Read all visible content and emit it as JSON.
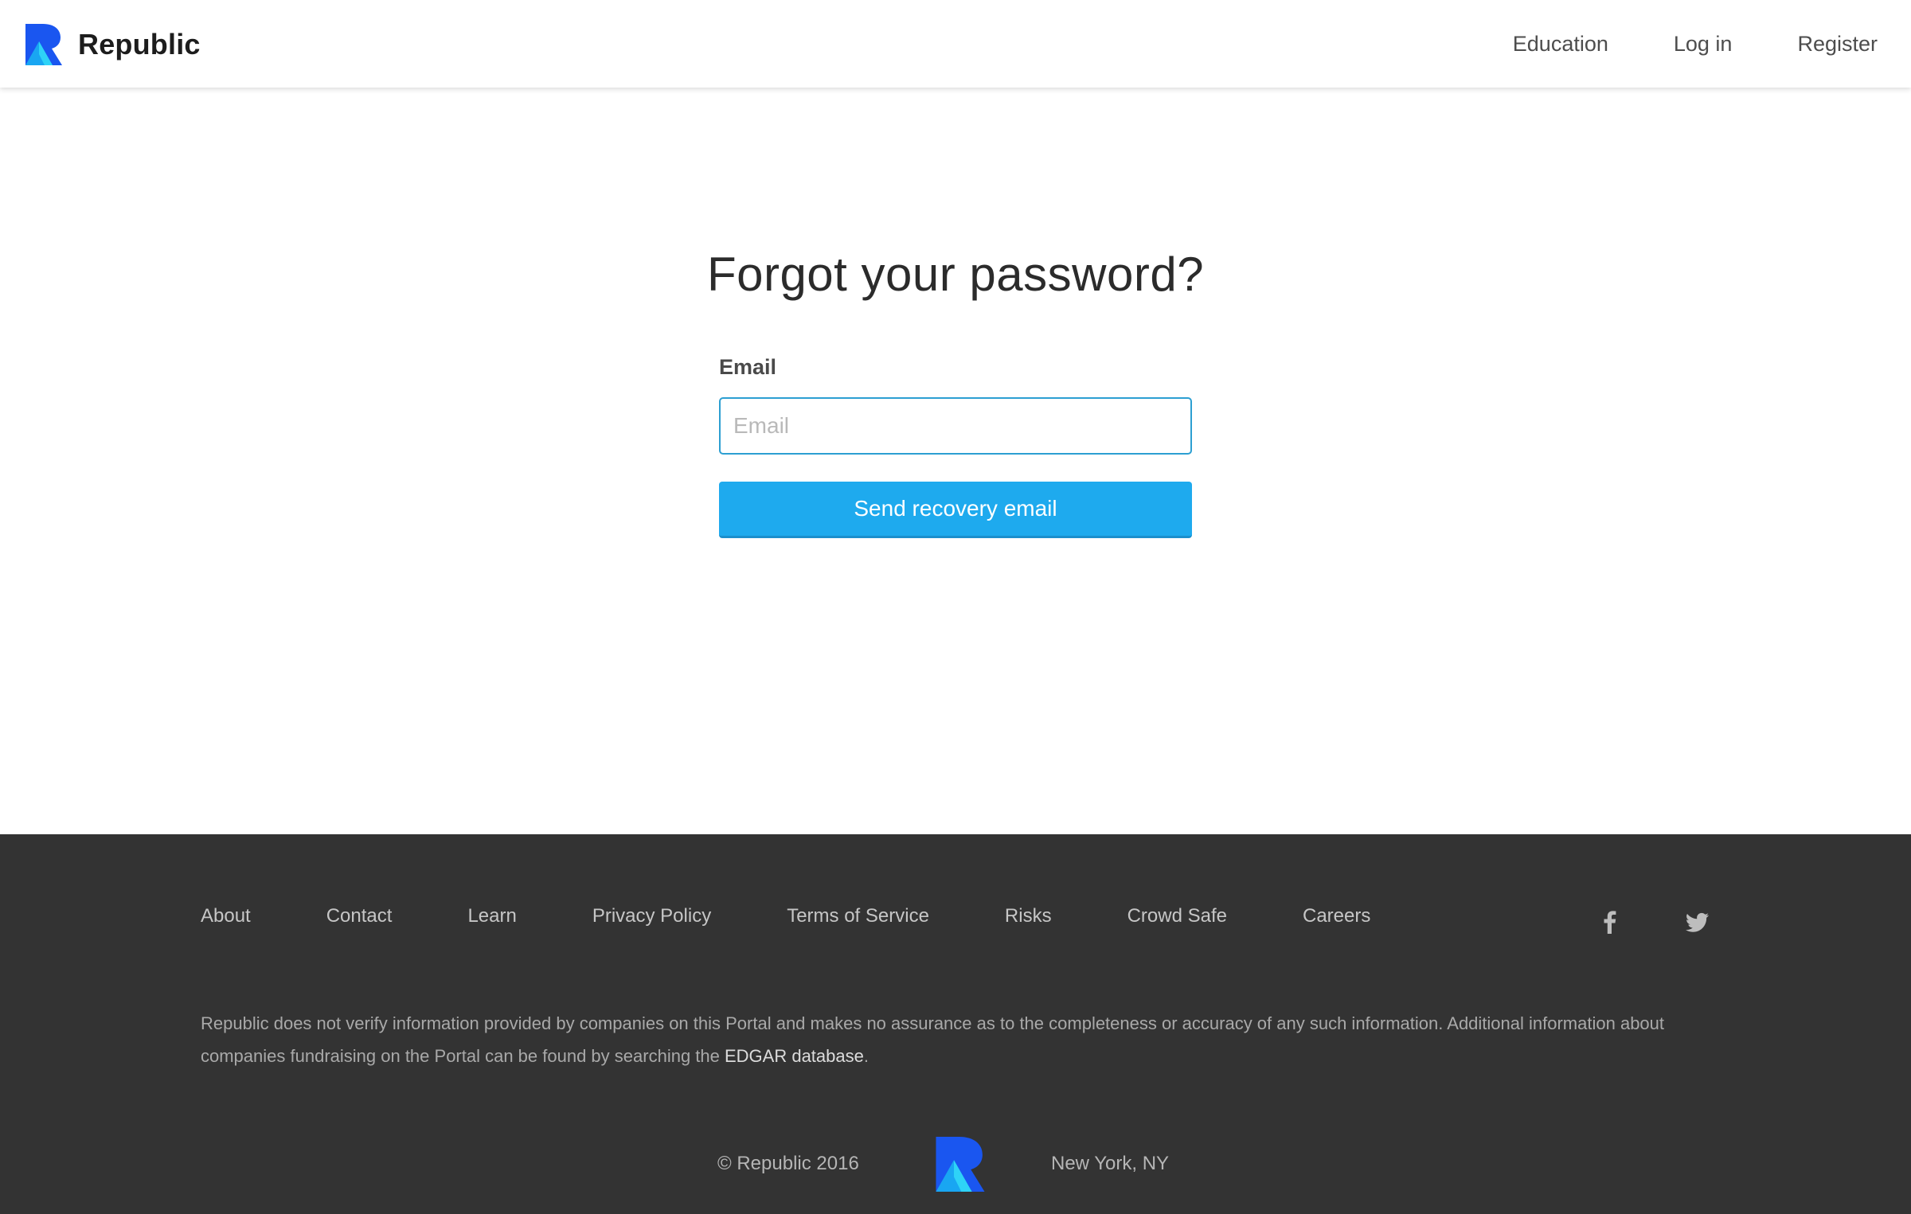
{
  "header": {
    "brand_name": "Republic",
    "nav": [
      {
        "label": "Education"
      },
      {
        "label": "Log in"
      },
      {
        "label": "Register"
      }
    ]
  },
  "main": {
    "title": "Forgot your password?",
    "email_label": "Email",
    "email_value": "",
    "email_placeholder": "Email",
    "submit_label": "Send recovery email"
  },
  "footer": {
    "links": [
      {
        "label": "About"
      },
      {
        "label": "Contact"
      },
      {
        "label": "Learn"
      },
      {
        "label": "Privacy Policy"
      },
      {
        "label": "Terms of Service"
      },
      {
        "label": "Risks"
      },
      {
        "label": "Crowd Safe"
      },
      {
        "label": "Careers"
      }
    ],
    "social": [
      {
        "icon": "facebook-icon"
      },
      {
        "icon": "twitter-icon"
      }
    ],
    "disclaimer_text": "Republic does not verify information provided by companies on this Portal and makes no assurance as to the completeness or accuracy of any such information. Additional information about companies fundraising on the Portal can be found by searching the ",
    "disclaimer_link": "EDGAR database",
    "disclaimer_end": ".",
    "copyright": "© Republic 2016",
    "location": "New York, NY"
  },
  "colors": {
    "accent": "#1eaaee",
    "input_border": "#2c9fd2",
    "footer_bg": "#333333",
    "logo_dark": "#1a56f0",
    "logo_light": "#1ec4f5"
  }
}
